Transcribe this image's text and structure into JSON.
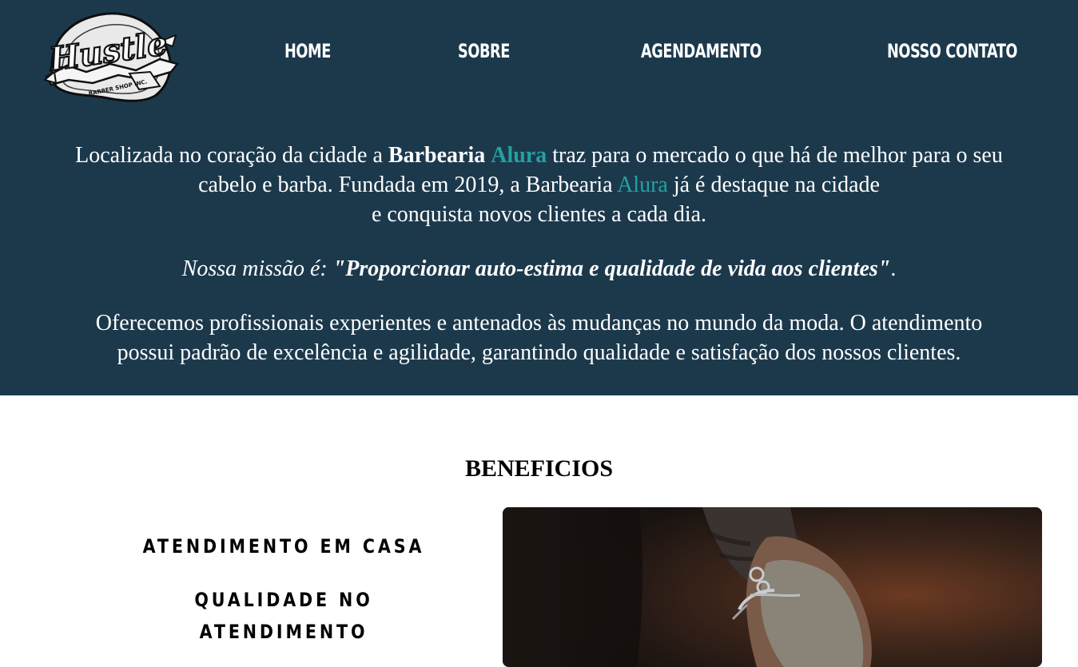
{
  "header": {
    "logo": {
      "icon": "hustle-barber-shop-logo",
      "text": "Hustle",
      "subtext": "BARBER SHOP INC."
    },
    "nav": [
      {
        "label": "HOME"
      },
      {
        "label": "SOBRE"
      },
      {
        "label": "AGENDAMENTO"
      },
      {
        "label": "NOSSO CONTATO"
      }
    ]
  },
  "about": {
    "p1_line1_a": "Localizada no coração da cidade a ",
    "p1_bold_barbearia": "Barbearia",
    "p1_bold_alura": "Alura",
    "p1_line1_b": " traz para o mercado o que há de melhor para o seu",
    "p1_line2_a": "cabelo e barba. Fundada em 2019, a Barbearia ",
    "p1_line2_alura": "Alura",
    "p1_line2_b": " já é destaque na cidade",
    "p1_line3": "e conquista novos clientes a cada dia.",
    "mission_label": "Nossa missão é: ",
    "mission_quote": "\"Proporcionar auto-estima e qualidade de vida aos clientes\"",
    "mission_end": ".",
    "p3_line1": "Oferecemos profissionais experientes e antenados às mudanças no mundo da moda. O atendimento",
    "p3_line2": "possui padrão de excelência e agilidade, garantindo qualidade e satisfação dos nossos clientes."
  },
  "beneficios": {
    "title": "BENEFICIOS",
    "items": [
      {
        "label": "ATENDIMENTO EM CASA"
      },
      {
        "label": "QUALIDADE NO ATENDIMENTO"
      }
    ],
    "photo": {
      "icon": "barber-trimming-beard-photo"
    }
  },
  "colors": {
    "header_bg": "#1c394c",
    "accent": "#22a2a1",
    "text_light": "#ffffff",
    "text_dark": "#000000"
  }
}
